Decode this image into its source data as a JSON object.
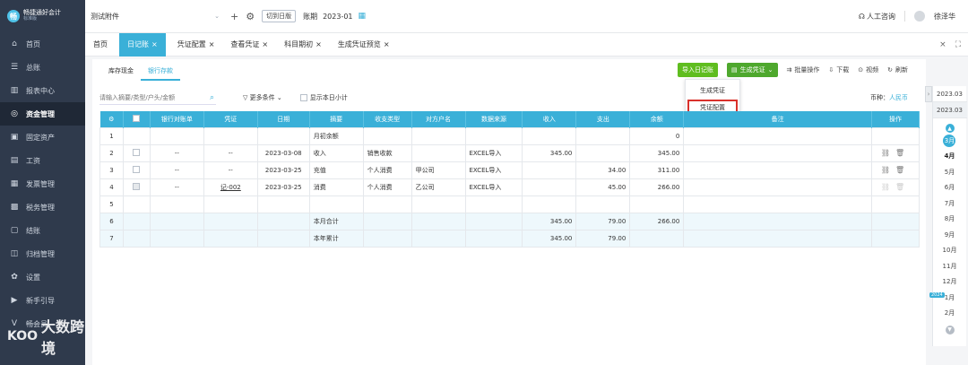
{
  "brand": {
    "name": "畅捷通好会计",
    "edition": "标准版"
  },
  "sidebar": {
    "items": [
      {
        "label": "首页",
        "icon": "home-icon",
        "glyph": "⌂"
      },
      {
        "label": "总账",
        "icon": "ledger-icon",
        "glyph": "☰"
      },
      {
        "label": "报表中心",
        "icon": "chart-icon",
        "glyph": "▥"
      },
      {
        "label": "资金管理",
        "icon": "money-icon",
        "glyph": "◎"
      },
      {
        "label": "固定资产",
        "icon": "asset-icon",
        "glyph": "▣"
      },
      {
        "label": "工资",
        "icon": "salary-icon",
        "glyph": "▤"
      },
      {
        "label": "发票管理",
        "icon": "invoice-icon",
        "glyph": "▦"
      },
      {
        "label": "税务管理",
        "icon": "tax-icon",
        "glyph": "▩"
      },
      {
        "label": "结账",
        "icon": "close-books-icon",
        "glyph": "▢"
      },
      {
        "label": "归档管理",
        "icon": "archive-icon",
        "glyph": "◫"
      },
      {
        "label": "设置",
        "icon": "gear-icon",
        "glyph": "✿"
      },
      {
        "label": "新手引导",
        "icon": "guide-icon",
        "glyph": "▶"
      },
      {
        "label": "畅会员",
        "icon": "vip-icon",
        "glyph": "V"
      }
    ],
    "active_index": 3
  },
  "watermark": {
    "mark": "KOO",
    "text": "大数跨境"
  },
  "topbar": {
    "company": "测试附件",
    "switch_label": "切到日版",
    "period_label": "账期",
    "period_value": "2023-01",
    "support_label": "人工咨询",
    "user_name": "徐泽华"
  },
  "tabs": [
    {
      "label": "首页",
      "closable": false
    },
    {
      "label": "日记账",
      "closable": true,
      "active": true
    },
    {
      "label": "凭证配置",
      "closable": true
    },
    {
      "label": "查看凭证",
      "closable": true
    },
    {
      "label": "科目期初",
      "closable": true
    },
    {
      "label": "生成凭证预览",
      "closable": true
    }
  ],
  "subtabs": [
    {
      "label": "库存现金"
    },
    {
      "label": "银行存款",
      "active": true
    }
  ],
  "actions": {
    "import_label": "导入日记账",
    "generate_label": "生成凭证",
    "batch_label": "批量操作",
    "download_label": "下载",
    "video_label": "视频",
    "refresh_label": "刷新"
  },
  "dropdown": {
    "items": [
      "生成凭证",
      "凭证配置"
    ],
    "highlighted_index": 1
  },
  "filter": {
    "search_placeholder": "请输入摘要/类型/户头/金额",
    "more_label": "更多条件",
    "daily_subtotal_label": "显示本日小计",
    "currency_label": "币种：",
    "currency_value": "人民币"
  },
  "table": {
    "headers": [
      "",
      "",
      "银行对账单",
      "凭证",
      "日期",
      "摘要",
      "收支类型",
      "对方户名",
      "数据来源",
      "收入",
      "支出",
      "余额",
      "备注",
      "操作"
    ],
    "rows": [
      {
        "no": "1",
        "check": "",
        "stmt": "",
        "voucher": "",
        "date": "",
        "summary": "月初余额",
        "type": "",
        "party": "",
        "source": "",
        "income": "",
        "expense": "",
        "balance": "0",
        "note": "",
        "ops": "",
        "sub": false
      },
      {
        "no": "2",
        "check": "box",
        "stmt": "--",
        "voucher": "--",
        "date": "2023-03-08",
        "summary": "收入",
        "type": "销售收款",
        "party": "",
        "source": "EXCEL导入",
        "income": "345.00",
        "expense": "",
        "balance": "345.00",
        "note": "",
        "ops": "link-trash",
        "sub": false
      },
      {
        "no": "3",
        "check": "box",
        "stmt": "--",
        "voucher": "--",
        "date": "2023-03-25",
        "summary": "充值",
        "type": "个人消费",
        "party": "甲公司",
        "source": "EXCEL导入",
        "income": "",
        "expense": "34.00",
        "balance": "311.00",
        "note": "",
        "ops": "link-trash",
        "sub": false
      },
      {
        "no": "4",
        "check": "disabled",
        "stmt": "--",
        "voucher": "记-002",
        "date": "2023-03-25",
        "summary": "消费",
        "type": "个人消费",
        "party": "乙公司",
        "source": "EXCEL导入",
        "income": "",
        "expense": "45.00",
        "balance": "266.00",
        "note": "",
        "ops": "link-trash-dis",
        "sub": false
      },
      {
        "no": "5",
        "check": "",
        "stmt": "",
        "voucher": "",
        "date": "",
        "summary": "",
        "type": "",
        "party": "",
        "source": "",
        "income": "",
        "expense": "",
        "balance": "",
        "note": "",
        "ops": "",
        "sub": false
      },
      {
        "no": "6",
        "check": "",
        "stmt": "",
        "voucher": "",
        "date": "",
        "summary": "本月合计",
        "type": "",
        "party": "",
        "source": "",
        "income": "345.00",
        "expense": "79.00",
        "balance": "266.00",
        "note": "",
        "ops": "",
        "sub": true
      },
      {
        "no": "7",
        "check": "",
        "stmt": "",
        "voucher": "",
        "date": "",
        "summary": "本年累计",
        "type": "",
        "party": "",
        "source": "",
        "income": "345.00",
        "expense": "79.00",
        "balance": "",
        "note": "",
        "ops": "",
        "sub": true
      }
    ]
  },
  "monthbar": {
    "years": [
      "2023.03",
      "2023.03"
    ],
    "months": [
      "3月",
      "4月",
      "5月",
      "6月",
      "7月",
      "8月",
      "9月",
      "10月",
      "11月",
      "12月",
      "1月",
      "2月"
    ],
    "selected_index": 0,
    "bold_index": 1,
    "year_tag": "2024"
  }
}
